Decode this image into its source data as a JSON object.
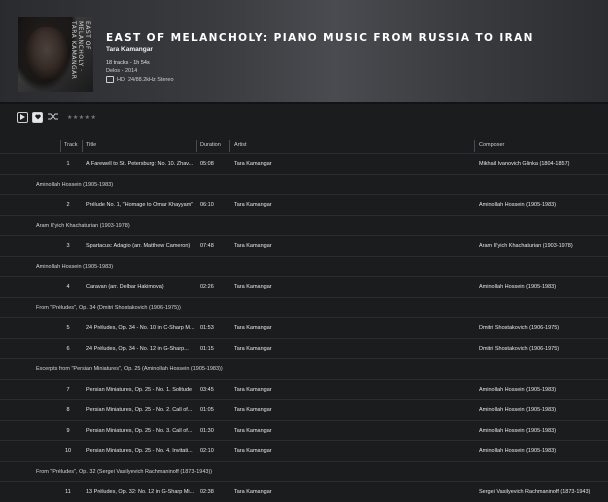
{
  "album": {
    "cover_spine": "EAST OF MELANCHOLY · TARA KAMANGAR",
    "title": "EAST OF MELANCHOLY: PIANO MUSIC FROM RUSSIA TO IRAN",
    "artist": "Tara Kamangar",
    "tracks_info": "18 tracks - 1h 54s",
    "label_year": "Delos - 2014",
    "quality_badge": "HD",
    "quality": "24/88.2kHz Stereo"
  },
  "toolbar": {
    "stars": "★★★★★"
  },
  "columns": {
    "track": "Track",
    "title": "Title",
    "duration": "Duration",
    "artist": "Artist",
    "composer": "Composer"
  },
  "rows": [
    {
      "type": "track",
      "num": "1",
      "title": "A Farewell to St. Petersburg: No. 10. Zhav...",
      "duration": "05:08",
      "artist": "Tara Kamangar",
      "composer": "Mikhail Ivanovich Glinka (1804-1857)"
    },
    {
      "type": "group",
      "label": "Aminollah Hossein (1905-1983)"
    },
    {
      "type": "track",
      "num": "2",
      "title": "Prélude No. 1, \"Homage to Omar Khayyam\"",
      "duration": "06:10",
      "artist": "Tara Kamangar",
      "composer": "Aminollah Hossein (1905-1983)"
    },
    {
      "type": "group",
      "label": "Aram Il'yich Khachaturian (1903-1978)"
    },
    {
      "type": "track",
      "num": "3",
      "title": "Spartacus: Adagio (arr. Matthew Cameron)",
      "duration": "07:48",
      "artist": "Tara Kamangar",
      "composer": "Aram Il'yich Khachaturian (1903-1978)"
    },
    {
      "type": "group",
      "label": "Aminollah Hossein (1905-1983)"
    },
    {
      "type": "track",
      "num": "4",
      "title": "Caravan (arr. Delbar Hakimova)",
      "duration": "02:26",
      "artist": "Tara Kamangar",
      "composer": "Aminollah Hossein (1905-1983)"
    },
    {
      "type": "group",
      "label": "From \"Préludes\", Op. 34 (Dmitri Shostakovich (1906-1975))"
    },
    {
      "type": "track",
      "num": "5",
      "title": "24 Préludes, Op. 34 - No. 10 in C-Sharp M...",
      "duration": "01:53",
      "artist": "Tara Kamangar",
      "composer": "Dmitri Shostakovich (1906-1975)"
    },
    {
      "type": "track",
      "num": "6",
      "title": "24 Préludes, Op. 34 - No. 12 in G-Sharp...",
      "duration": "01:15",
      "artist": "Tara Kamangar",
      "composer": "Dmitri Shostakovich (1906-1975)"
    },
    {
      "type": "group",
      "label": "Excerpts from \"Persian Miniatures\", Op. 25 (Aminollah Hossein (1905-1983))"
    },
    {
      "type": "track",
      "num": "7",
      "title": "Persian Miniatures, Op. 25 - No. 1. Solitude",
      "duration": "03:45",
      "artist": "Tara Kamangar",
      "composer": "Aminollah Hossein (1905-1983)"
    },
    {
      "type": "track",
      "num": "8",
      "title": "Persian Miniatures, Op. 25 - No. 2. Call of...",
      "duration": "01:05",
      "artist": "Tara Kamangar",
      "composer": "Aminollah Hossein (1905-1983)"
    },
    {
      "type": "track",
      "num": "9",
      "title": "Persian Miniatures, Op. 25 - No. 3. Call of...",
      "duration": "01:30",
      "artist": "Tara Kamangar",
      "composer": "Aminollah Hossein (1905-1983)"
    },
    {
      "type": "track",
      "num": "10",
      "title": "Persian Miniatures, Op. 25 - No. 4. Invitati...",
      "duration": "02:10",
      "artist": "Tara Kamangar",
      "composer": "Aminollah Hossein (1905-1983)"
    },
    {
      "type": "group",
      "label": "From \"Préludes\", Op. 32 (Sergei Vasilyevich Rachmaninoff (1873-1943))"
    },
    {
      "type": "track",
      "num": "11",
      "title": "13 Préludes, Op. 32: No. 12 in G-Sharp Mi...",
      "duration": "02:38",
      "artist": "Tara Kamangar",
      "composer": "Sergei Vasilyevich Rachmaninoff (1873-1943)"
    }
  ],
  "colors": {
    "background": "#1b1c1e",
    "row_border": "#2b2c2f",
    "text": "#e6e6e6"
  }
}
